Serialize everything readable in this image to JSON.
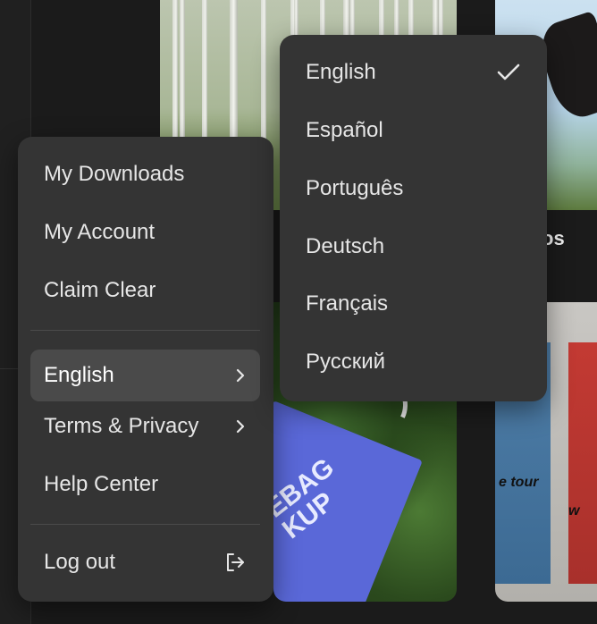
{
  "background": {
    "sky_caption": "os",
    "tote_text": "EBAG\nKUP",
    "poster_labels": [
      "e tour",
      "w"
    ],
    "bottom_captions": [
      "",
      ""
    ]
  },
  "menu": {
    "items": [
      {
        "label": "My Downloads"
      },
      {
        "label": "My Account"
      },
      {
        "label": "Claim Clear"
      }
    ],
    "language": {
      "label": "English"
    },
    "terms": {
      "label": "Terms & Privacy"
    },
    "help": {
      "label": "Help Center"
    },
    "logout": {
      "label": "Log out"
    }
  },
  "language_menu": {
    "selected": "English",
    "options": [
      {
        "label": "English",
        "selected": true
      },
      {
        "label": "Español",
        "selected": false
      },
      {
        "label": "Português",
        "selected": false
      },
      {
        "label": "Deutsch",
        "selected": false
      },
      {
        "label": "Français",
        "selected": false
      },
      {
        "label": "Русский",
        "selected": false
      }
    ]
  },
  "colors": {
    "menu_bg": "#343434",
    "active_bg": "#4a4a4a",
    "text": "#e6e6e6",
    "page_bg": "#1b1b1b"
  },
  "icons": {
    "chevron": "chevron-right-icon",
    "logout": "logout-icon",
    "check": "check-icon"
  }
}
